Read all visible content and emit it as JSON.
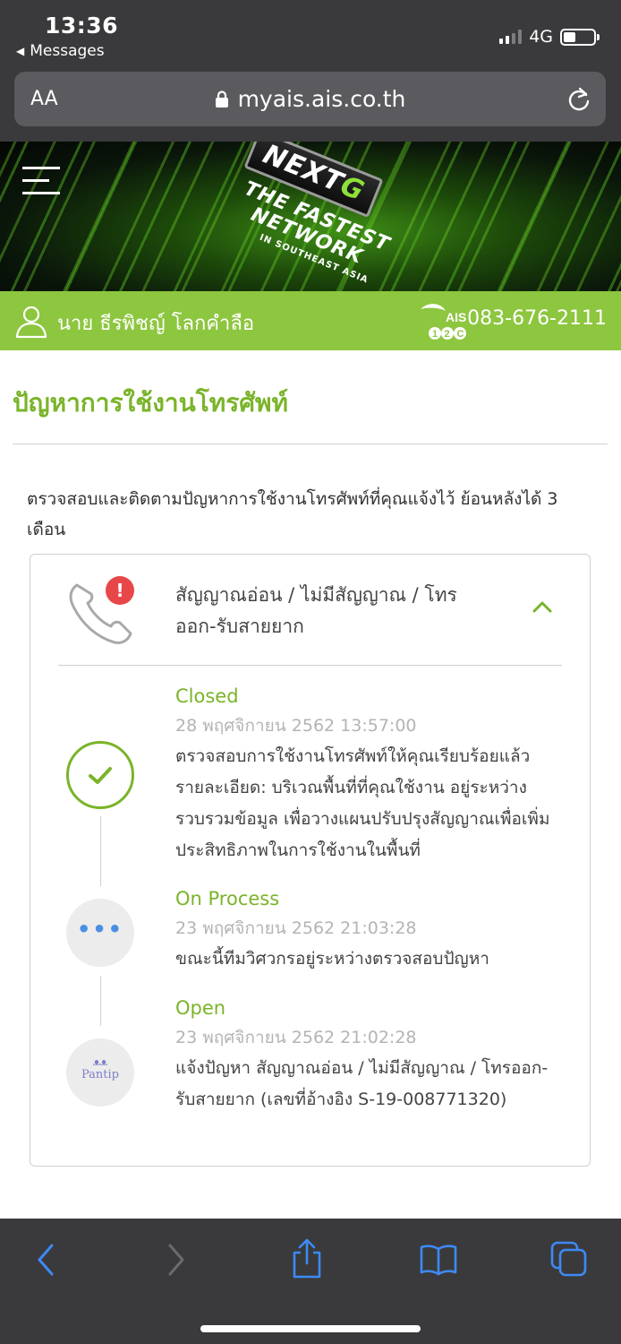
{
  "status_bar": {
    "time": "13:36",
    "back_label": "Messages",
    "network": "4G"
  },
  "browser": {
    "aa_label": "AA",
    "url": "myais.ais.co.th"
  },
  "banner": {
    "logo_main": "NEXT",
    "logo_accent": "G",
    "tagline1": "THE FASTEST",
    "tagline2": "NETWORK",
    "tagline3": "IN SOUTHEAST ASIA"
  },
  "user_bar": {
    "user_name": "นาย ธีรพิชญ์ โลกคำลือ",
    "brand_top": "AIS",
    "brand_bottom": "12C",
    "phone_number": "083-676-2111"
  },
  "page": {
    "title": "ปัญหาการใช้งานโทรศัพท์",
    "description": "ตรวจสอบและติดตามปัญหาการใช้งานโทรศัพท์ที่คุณแจ้งไว้ ย้อนหลังได้ 3 เดือน"
  },
  "issue": {
    "badge": "!",
    "title": "สัญญาณอ่อน / ไม่มีสัญญาณ / โทรออก-รับสายยาก",
    "events": [
      {
        "status": "Closed",
        "date": "28 พฤศจิกายน 2562 13:57:00",
        "text": "ตรวจสอบการใช้งานโทรศัพท์ให้คุณเรียบร้อยแล้ว รายละเอียด: บริเวณพื้นที่ที่คุณใช้งาน อยู่ระหว่างรวบรวมข้อมูล เพื่อวางแผนปรับปรุงสัญญาณเพื่อเพิ่มประสิทธิภาพในการใช้งานในพื้นที่"
      },
      {
        "status": "On Process",
        "date": "23 พฤศจิกายน 2562 21:03:28",
        "text": "ขณะนี้ทีมวิศวกรอยู่ระหว่างตรวจสอบปัญหา",
        "icon_text": "•••"
      },
      {
        "status": "Open",
        "date": "23 พฤศจิกายน 2562 21:02:28",
        "text": "แจ้งปัญหา สัญญาณอ่อน / ไม่มีสัญญาณ / โทรออก-รับสายยาก (เลขที่อ้างอิง S-19-008771320)",
        "icon_text": "Pantip"
      }
    ]
  },
  "icons": {
    "back": "chevron-left-icon",
    "forward": "chevron-right-icon",
    "share": "share-icon",
    "bookmarks": "book-icon",
    "tabs": "tabs-icon"
  },
  "colors": {
    "brand_green": "#8dc63f",
    "title_green": "#7ab42a",
    "alert_red": "#e8474a",
    "ios_blue": "#3d8af7"
  }
}
